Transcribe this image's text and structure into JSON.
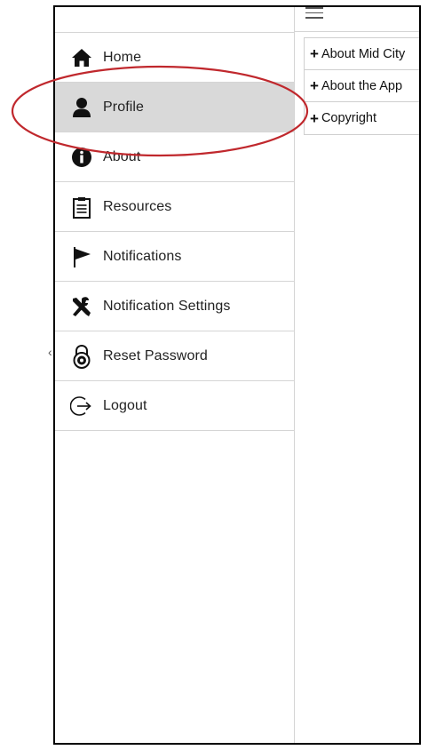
{
  "sidebar": {
    "items": [
      {
        "label": "Home",
        "icon": "home-icon"
      },
      {
        "label": "Profile",
        "icon": "user-icon",
        "active": true
      },
      {
        "label": "About",
        "icon": "info-icon"
      },
      {
        "label": "Resources",
        "icon": "clipboard-icon"
      },
      {
        "label": "Notifications",
        "icon": "flag-icon"
      },
      {
        "label": "Notification Settings",
        "icon": "tools-icon"
      },
      {
        "label": "Reset Password",
        "icon": "lock-icon"
      },
      {
        "label": "Logout",
        "icon": "logout-icon"
      }
    ]
  },
  "content": {
    "accordion": [
      {
        "label": "About Mid City"
      },
      {
        "label": "About the App"
      },
      {
        "label": "Copyright"
      }
    ]
  },
  "colors": {
    "active_bg": "#d9d9d9",
    "annotation_red": "#c0282d",
    "divider": "#d5d5d5"
  }
}
